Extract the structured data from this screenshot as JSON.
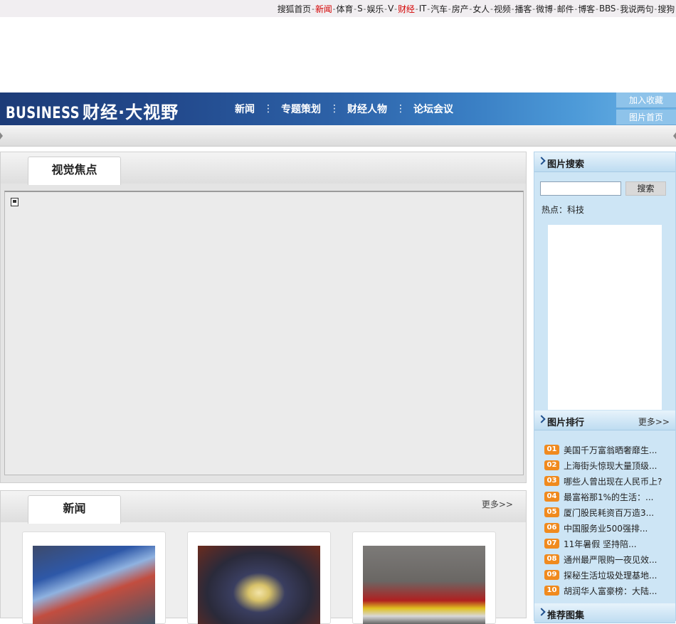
{
  "topbar": {
    "items": [
      {
        "label": "搜狐首页",
        "red": false
      },
      {
        "label": "新闻",
        "red": true
      },
      {
        "label": "体育",
        "red": false
      },
      {
        "label": "S",
        "red": false
      },
      {
        "label": "娱乐",
        "red": false
      },
      {
        "label": "V",
        "red": false
      },
      {
        "label": "财经",
        "red": true
      },
      {
        "label": "IT",
        "red": false
      },
      {
        "label": "汽车",
        "red": false
      },
      {
        "label": "房产",
        "red": false
      },
      {
        "label": "女人",
        "red": false
      },
      {
        "label": "视频",
        "red": false
      },
      {
        "label": "播客",
        "red": false
      },
      {
        "label": "微博",
        "red": false
      },
      {
        "label": "邮件",
        "red": false
      },
      {
        "label": "博客",
        "red": false
      },
      {
        "label": "BBS",
        "red": false
      },
      {
        "label": "我说两句",
        "red": false
      },
      {
        "label": "搜狗",
        "red": false
      }
    ],
    "separator": "-"
  },
  "banner": {
    "brand_en": "BUSINESS",
    "brand_cn": "财经·大视野",
    "nav": [
      "新闻",
      "专题策划",
      "财经人物",
      "论坛会议"
    ],
    "nav_separator": "⋮",
    "bookmark_label": "加入收藏",
    "photo_home_label": "图片首页"
  },
  "focus": {
    "tab_label": "视觉焦点"
  },
  "news": {
    "tab_label": "新闻",
    "more_label": "更多>>"
  },
  "sidebar": {
    "search_title": "图片搜索",
    "search_button": "搜索",
    "search_value": "",
    "hot_label": "热点：科技",
    "ranking_title": "图片排行",
    "ranking_more": "更多>>",
    "ranking": [
      {
        "num": "01",
        "text": "美国千万富翁晒奢靡生..."
      },
      {
        "num": "02",
        "text": "上海街头惊现大量顶级..."
      },
      {
        "num": "03",
        "text": "哪些人曾出现在人民币上?"
      },
      {
        "num": "04",
        "text": "最富裕那1%的生活：..."
      },
      {
        "num": "05",
        "text": "厦门股民耗资百万造3..."
      },
      {
        "num": "06",
        "text": "中国服务业500强排..."
      },
      {
        "num": "07",
        "text": "11年暑假 坚持陪..."
      },
      {
        "num": "08",
        "text": "通州最严限购一夜见效..."
      },
      {
        "num": "09",
        "text": "探秘生活垃圾处理基地..."
      },
      {
        "num": "10",
        "text": "胡润华人富豪榜：大陆..."
      }
    ],
    "recommend_title": "推荐图集"
  },
  "colors": {
    "red_link": "#d40000",
    "banner_dark": "#1d3c78",
    "banner_light": "#6db4e6",
    "sidebar_bg": "#cde5f5",
    "rank_badge": "#f08a1e"
  }
}
